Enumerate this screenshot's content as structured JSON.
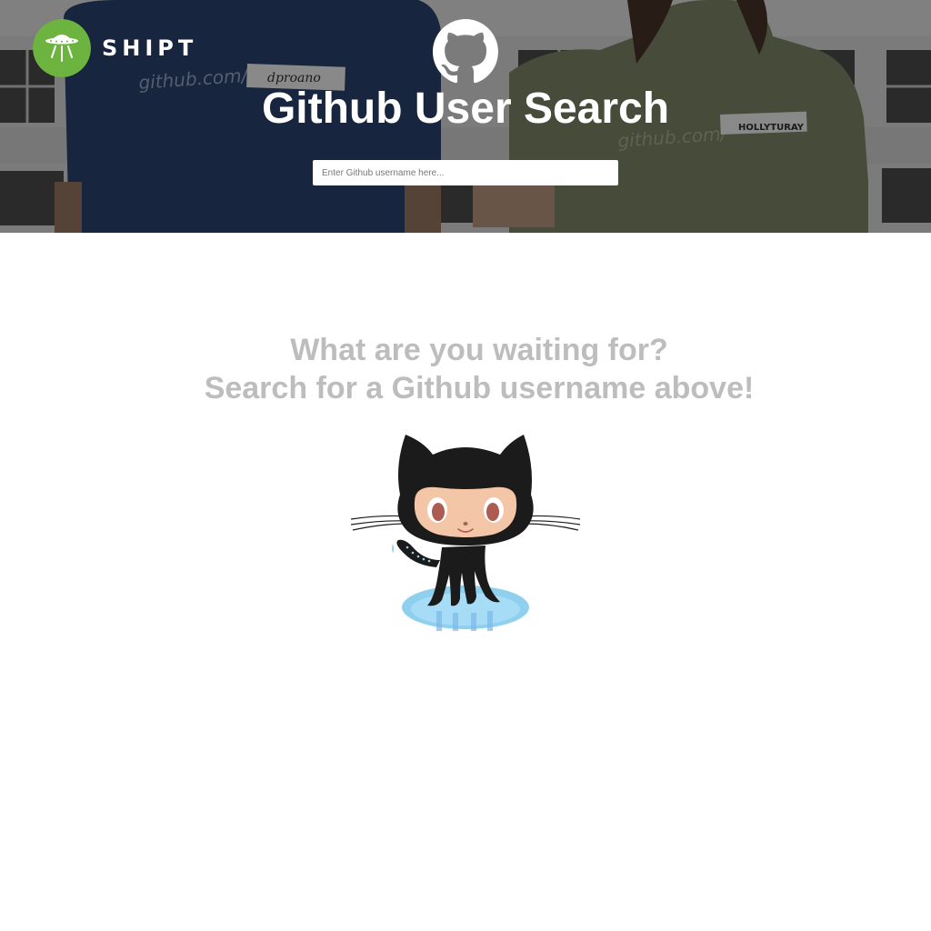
{
  "header": {
    "brand_name": "SHIPT",
    "brand_logo_icon": "ufo-icon",
    "brand_color": "#6cb33f",
    "github_mark_icon": "github-octocat-icon",
    "title": "Github User Search",
    "background_shirt_texts": [
      "github.com/",
      "dproano",
      "github.com/",
      "HOLLYTURAY"
    ]
  },
  "search": {
    "placeholder": "Enter Github username here...",
    "value": ""
  },
  "empty_state": {
    "line1": "What are you waiting for?",
    "line2": "Search for a Github username above!",
    "illustration_icon": "octocat-illustration"
  }
}
